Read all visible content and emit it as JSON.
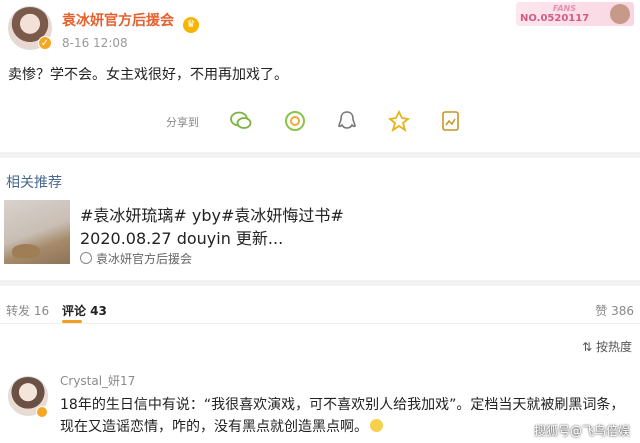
{
  "post": {
    "username": "袁冰妍官方后援会",
    "time": "8-16 12:08",
    "text": "卖惨？学不会。女主戏很好，不用再加戏了。",
    "fans_badge": {
      "label": "FANS",
      "number": "NO.0520117"
    }
  },
  "share": {
    "label": "分享到",
    "icons": [
      "wechat-icon",
      "moments-icon",
      "qq-icon",
      "qzone-icon",
      "save-image-icon"
    ]
  },
  "related": {
    "title": "相关推荐",
    "card": {
      "title_line1": "#袁冰妍琉璃# yby#袁冰妍悔过书#",
      "title_line2": "2020.08.27 douyin 更新...",
      "source": "袁冰妍官方后援会"
    }
  },
  "tabs": {
    "repost": "转发 16",
    "comments": "评论 43",
    "likes": "赞 386"
  },
  "sort": {
    "label": "按热度"
  },
  "comment": {
    "username": "Crystal_妍17",
    "text": "18年的生日信中有说：“我很喜欢演戏，可不喜欢别人给我加戏”。定档当天就被刷黑词条，现在又造谣恋情，咋的，没有黑点就创造黑点啊。"
  },
  "watermark": "搜狐号@飞鸟倍娱",
  "colors": {
    "username": "#e5602e",
    "link": "#4a6a90",
    "accent": "#f0a020"
  }
}
